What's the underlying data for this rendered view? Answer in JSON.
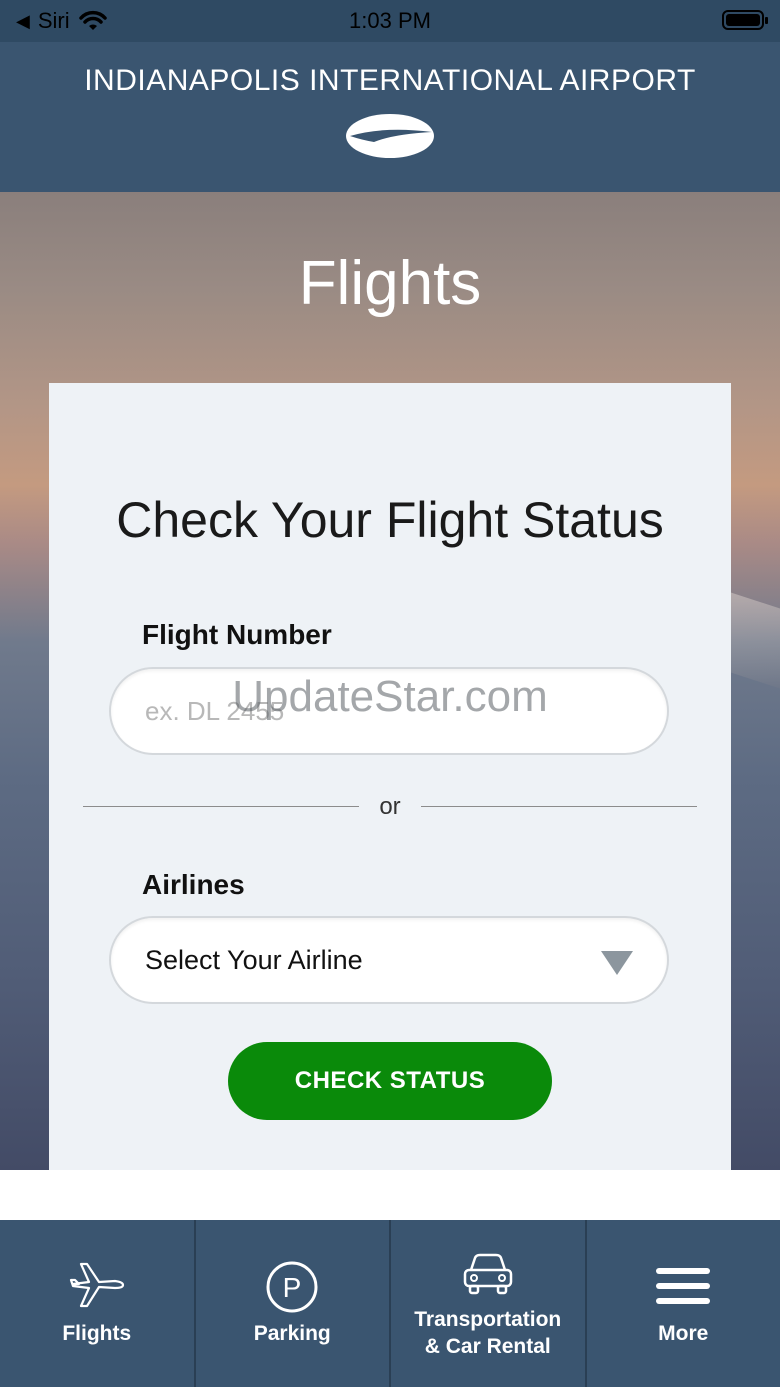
{
  "status_bar": {
    "back_label": "Siri",
    "time": "1:03 PM"
  },
  "header": {
    "title": "INDIANAPOLIS INTERNATIONAL AIRPORT"
  },
  "page": {
    "title": "Flights"
  },
  "card": {
    "title": "Check Your Flight Status",
    "flight_number_label": "Flight Number",
    "flight_number_placeholder": "ex. DL 2455",
    "divider_text": "or",
    "airlines_label": "Airlines",
    "airline_select_value": "Select Your Airline",
    "check_button_label": "CHECK STATUS"
  },
  "watermark": "UpdateStar.com",
  "bottom_nav": [
    {
      "label": "Flights",
      "icon": "airplane-icon"
    },
    {
      "label": "Parking",
      "icon": "parking-icon"
    },
    {
      "label": "Transportation & Car Rental",
      "label_line1": "Transportation",
      "label_line2": "& Car Rental",
      "icon": "car-icon"
    },
    {
      "label": "More",
      "icon": "menu-icon"
    }
  ],
  "colors": {
    "header_bg": "#3a5570",
    "button_green": "#0a8a0a",
    "card_bg": "#eef2f6"
  }
}
